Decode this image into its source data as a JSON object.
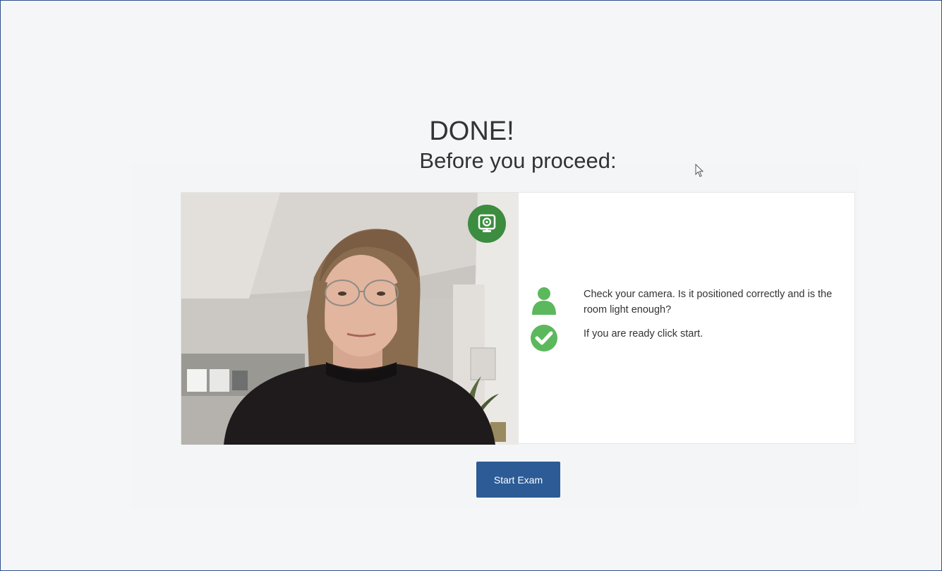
{
  "header": {
    "title": "DONE!",
    "subtitle": "Before you proceed:"
  },
  "camera": {
    "badge_icon": "webcam-icon",
    "badge_color": "#3c8d3f"
  },
  "instructions": {
    "items": [
      {
        "icon": "person-icon",
        "text": "Check your camera. Is it positioned correctly and is the room light enough?"
      },
      {
        "icon": "check-circle-icon",
        "text": "If you are ready click start."
      }
    ],
    "icon_color": "#5cb85c"
  },
  "actions": {
    "start_label": "Start Exam",
    "start_color": "#2c5b96"
  }
}
